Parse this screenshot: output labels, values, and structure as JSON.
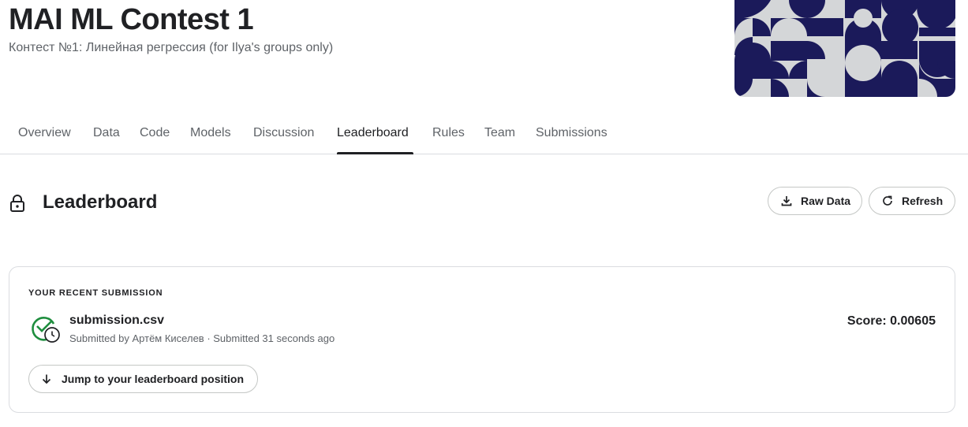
{
  "competition": {
    "title": "MAI ML Contest 1",
    "subtitle": "Контест №1: Линейная регрессия (for Ilya's groups only)"
  },
  "tabs": [
    {
      "label": "Overview"
    },
    {
      "label": "Data"
    },
    {
      "label": "Code"
    },
    {
      "label": "Models"
    },
    {
      "label": "Discussion"
    },
    {
      "label": "Leaderboard",
      "active": true
    },
    {
      "label": "Rules"
    },
    {
      "label": "Team"
    },
    {
      "label": "Submissions"
    }
  ],
  "leaderboard": {
    "title": "Leaderboard",
    "lock_icon": "lock-icon",
    "raw_data_label": "Raw Data",
    "raw_data_icon": "download-icon",
    "refresh_label": "Refresh",
    "refresh_icon": "refresh-icon"
  },
  "recent_submission": {
    "section_label": "YOUR RECENT SUBMISSION",
    "file_name": "submission.csv",
    "submitted_by_prefix": "Submitted by",
    "author": "Артём Киселев",
    "separator": " · ",
    "submitted_time": "Submitted 31 seconds ago",
    "score_label": "Score:",
    "score_value": "0.00605",
    "status_icon": "check-circle-clock-icon",
    "jump_label": "Jump to your leaderboard position",
    "jump_icon": "arrow-down-icon"
  },
  "colors": {
    "banner_navy": "#1b1a5a",
    "banner_gray": "#d4d6d8",
    "success_green": "#1e8e3e",
    "text_primary": "#202124",
    "text_secondary": "#5f6368"
  }
}
